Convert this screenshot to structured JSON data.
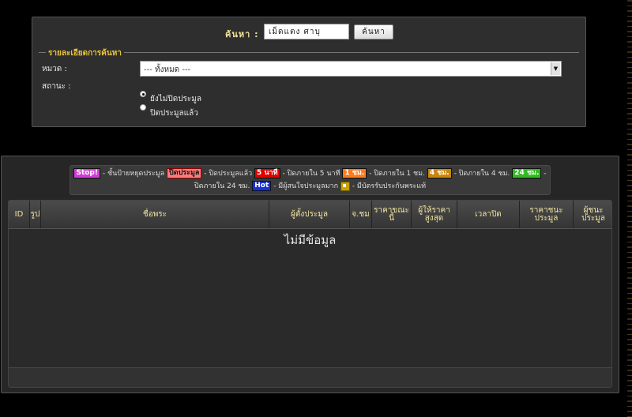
{
  "search": {
    "label": "ค้นหา :",
    "input_value": "เม็ดแตง ศาบุ",
    "button_label": "ค้นหา"
  },
  "details": {
    "legend": "รายละเอียดการค้นหา",
    "category_label": "หมวด :",
    "category_selected": "--- ทั้งหมด ---",
    "status_label": "สถานะ :",
    "status_options": [
      "ยังไม่ปิดประมูล",
      "ปิดประมูลแล้ว"
    ],
    "status_selected": "ยังไม่ปิดประมูล"
  },
  "legend": {
    "stop_badge": "Stop!",
    "stop_text": "- ชั้นป้ายหยุดประมูล",
    "closed_badge": "ปิดประมูล",
    "closed_text": "- ปิดประมูลแล้ว",
    "min5_badge": "5 นาที",
    "min5_text": "- ปิดภายใน 5 นาที",
    "hr1_badge": "1 ชม.",
    "hr1_text": "- ปิดภายใน 1 ชม.",
    "hr4_badge": "4 ชม.",
    "hr4_text": "- ปิดภายใน 4 ชม.",
    "hr24_badge": "24 ชม.",
    "hr24_text": "- ปิดภายใน 24 ชม.",
    "hot_badge": "Hot",
    "hot_text": "- มีผู้สนใจประมูลมาก",
    "cert_text": "- มีบัตรรับประกันพระแท้",
    "colors": {
      "stop": "#d53bd9",
      "closed": "#ff7b7b",
      "min5": "#e00000",
      "hr1": "#ff7a1a",
      "hr4": "#c9860d",
      "hr24": "#2ebd1d",
      "hot": "#1630d8"
    }
  },
  "table": {
    "columns": [
      "ID",
      "รูป",
      "ชื่อพระ",
      "ผู้ตั้งประมูล",
      "จ.ชม",
      "ราคาขณะนี้",
      "ผู้ให้ราคาสูงสุด",
      "เวลาปิด",
      "ราคาชนะประมูล",
      "ผู้ชนะประมูล"
    ],
    "empty_message": "ไม่มีข้อมูล"
  },
  "theme": {
    "header_text": "#f0e3a0",
    "legend_title": "#e7c13a",
    "search_label": "#f2e59c"
  }
}
